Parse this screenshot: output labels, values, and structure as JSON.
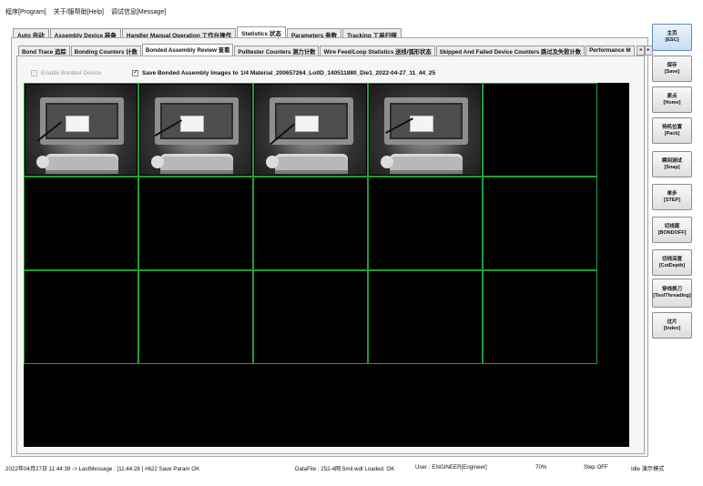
{
  "menu": [
    "程序[Program]",
    "关于/服帮助[Help]",
    "调试信息[Message]"
  ],
  "main_tabs": [
    {
      "label": "Auto 自动",
      "active": false
    },
    {
      "label": "Assembly Device 装备",
      "active": false
    },
    {
      "label": "Handler Manual Operation 工作台操作",
      "active": false
    },
    {
      "label": "Statistics 状态",
      "active": true
    },
    {
      "label": "Parameters 参数",
      "active": false
    },
    {
      "label": "Tracking 工单扫描",
      "active": false
    }
  ],
  "sub_tabs": [
    {
      "label": "Bond Trace 追踪",
      "active": false
    },
    {
      "label": "Bonding Counters 计数",
      "active": false
    },
    {
      "label": "Bonded Assembly Review 查看",
      "active": true
    },
    {
      "label": "Pulltester Counters 测力计数",
      "active": false
    },
    {
      "label": "Wire Feed/Loop Statistics 送线/弧形状态",
      "active": false
    },
    {
      "label": "Skipped And Failed Device Counters 跳过及失败计数",
      "active": false
    },
    {
      "label": "Performance M",
      "active": false
    }
  ],
  "tab_scroll": {
    "left": "◂",
    "right": "▸"
  },
  "options": {
    "enable_bonded_device": {
      "label": "Enable Bonded Device",
      "checked": false,
      "enabled": false
    },
    "save_images": {
      "label": "Save Bonded Assembly Images to",
      "checked": true
    },
    "image_path": "1/4 Material_200657264_LotID_140511880_Die1_2022-04-27_11_44_25"
  },
  "image_grid": {
    "rows": 3,
    "cols": 5,
    "filled_cells": 4,
    "grid_color": "#1f9f3a"
  },
  "side_buttons": [
    {
      "label": "主页",
      "sub": "[ESC]",
      "highlight": true
    },
    {
      "label": "保存",
      "sub": "[Save]"
    },
    {
      "label": "原点",
      "sub": "[Home]"
    },
    {
      "label": "待机位置",
      "sub": "[Pack]"
    },
    {
      "label": "瞬间测试",
      "sub": "[Snap]"
    },
    {
      "label": "单步",
      "sub": "[STEP]"
    },
    {
      "label": "切线尾",
      "sub": "[BONDOFF]"
    },
    {
      "label": "切线深度",
      "sub": "[CutDepth]"
    },
    {
      "label": "穿线换刀",
      "sub": "[ToolThreading]"
    },
    {
      "label": "过片",
      "sub": "[Index]"
    }
  ],
  "status": {
    "message": "2022年04月27日 11:44:39 -> LastMessage : [11:44:28 ] #622 Save Param OK",
    "datafile": "DataFile : 252-4网.5mil.wdt Loaded. OK",
    "user": "User : ENGINEER[Engineer]",
    "percent": "70%",
    "step": "Step OFF",
    "mode": "Idle 演示模式"
  }
}
